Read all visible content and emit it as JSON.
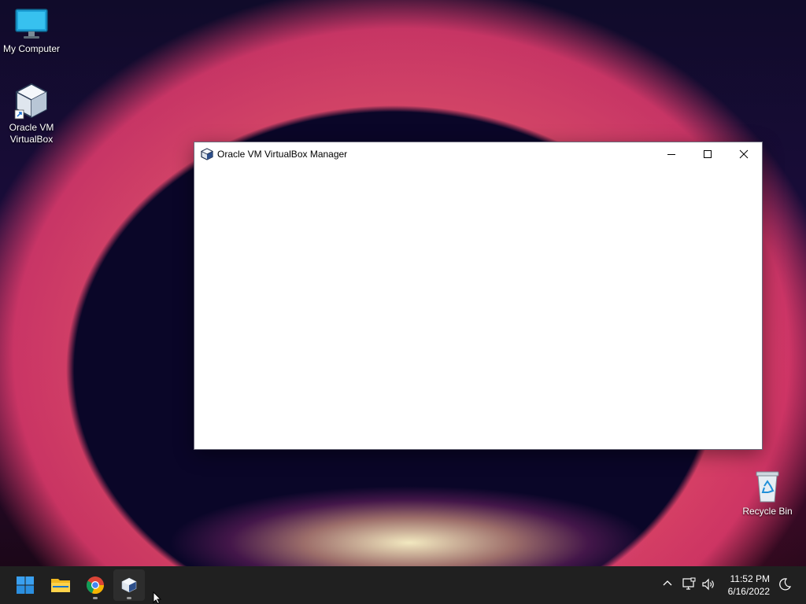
{
  "desktop": {
    "icons": [
      {
        "label": "My Computer",
        "icon": "monitor-icon"
      },
      {
        "label": "Oracle VM\nVirtualBox",
        "label_line1": "Oracle VM",
        "label_line2": "VirtualBox",
        "icon": "virtualbox-icon"
      },
      {
        "label": "Recycle Bin",
        "icon": "recycle-bin-icon"
      }
    ]
  },
  "window": {
    "title": "Oracle VM VirtualBox Manager",
    "minimize_icon": "minimize-icon",
    "maximize_icon": "maximize-icon",
    "close_icon": "close-icon"
  },
  "taskbar": {
    "apps": [
      {
        "name": "Start",
        "icon": "windows-start-icon"
      },
      {
        "name": "File Explorer",
        "icon": "folder-icon"
      },
      {
        "name": "Google Chrome",
        "icon": "chrome-icon",
        "running": true
      },
      {
        "name": "Oracle VM VirtualBox",
        "icon": "virtualbox-icon",
        "running": true,
        "active": true
      }
    ],
    "tray": {
      "icons": [
        "chevron-up-icon",
        "network-icon",
        "volume-icon",
        "moon-icon"
      ]
    },
    "clock": {
      "time": "11:52 PM",
      "date": "6/16/2022"
    }
  },
  "colors": {
    "taskbar_bg": "#202020",
    "window_bg": "#ffffff",
    "accent": "#0078d4"
  }
}
